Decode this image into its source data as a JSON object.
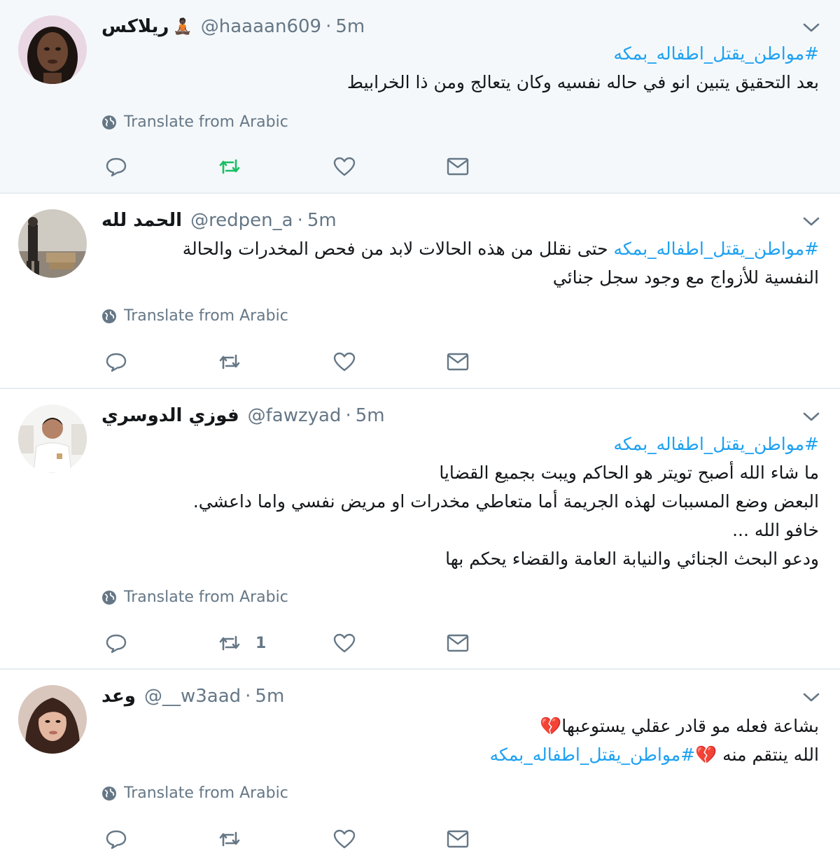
{
  "colors": {
    "link": "#1da1f2",
    "muted": "#657786",
    "retweeted": "#17bf63",
    "highlight_bg": "#f5f8fa"
  },
  "translate_label": "Translate from Arabic",
  "tweets": [
    {
      "name": "ريلاكس",
      "emoji": "🧘🏿",
      "handle": "@haaaan609",
      "time": "5m",
      "lines": [
        {
          "hashtag": "#مواطن_يقتل_اطفاله_بمكه"
        },
        {
          "text": "بعد التحقيق يتبين انو في حاله نفسيه وكان يتعالج ومن ذا الخرابيط"
        }
      ],
      "retweeted": true,
      "retweet_count": ""
    },
    {
      "name": "الحمد لله",
      "handle": "@redpen_a",
      "time": "5m",
      "lines": [
        {
          "hashtag": "#مواطن_يقتل_اطفاله_بمكه",
          "text": " حتى نقلل من هذه الحالات لابد من فحص المخدرات والحالة"
        },
        {
          "text": "النفسية للأزواج مع وجود سجل جنائي"
        }
      ],
      "retweeted": false,
      "retweet_count": ""
    },
    {
      "name": "فوزي الدوسري",
      "handle": "@fawzyad",
      "time": "5m",
      "lines": [
        {
          "hashtag": "#مواطن_يقتل_اطفاله_بمكه"
        },
        {
          "text": "ما شاء الله أصبح تويتر هو الحاكم ويبت بجميع القضايا"
        },
        {
          "text": "البعض وضع المسببات لهذه الجريمة أما متعاطي مخدرات او مريض نفسي واما داعشي."
        },
        {
          "text": "خافو الله ..."
        },
        {
          "text": "ودعو البحث الجنائي والنيابة العامة والقضاء يحكم بها"
        }
      ],
      "retweeted": false,
      "retweet_count": "1"
    },
    {
      "name": "وعد",
      "handle": "@__w3aad",
      "time": "5m",
      "lines": [
        {
          "text": "بشاعة فعله مو قادر عقلي يستوعبها",
          "emoji": "💔"
        },
        {
          "text": "الله ينتقم منه ",
          "emoji": "💔",
          "hashtag": "#مواطن_يقتل_اطفاله_بمكه"
        }
      ],
      "retweeted": false,
      "retweet_count": ""
    }
  ]
}
